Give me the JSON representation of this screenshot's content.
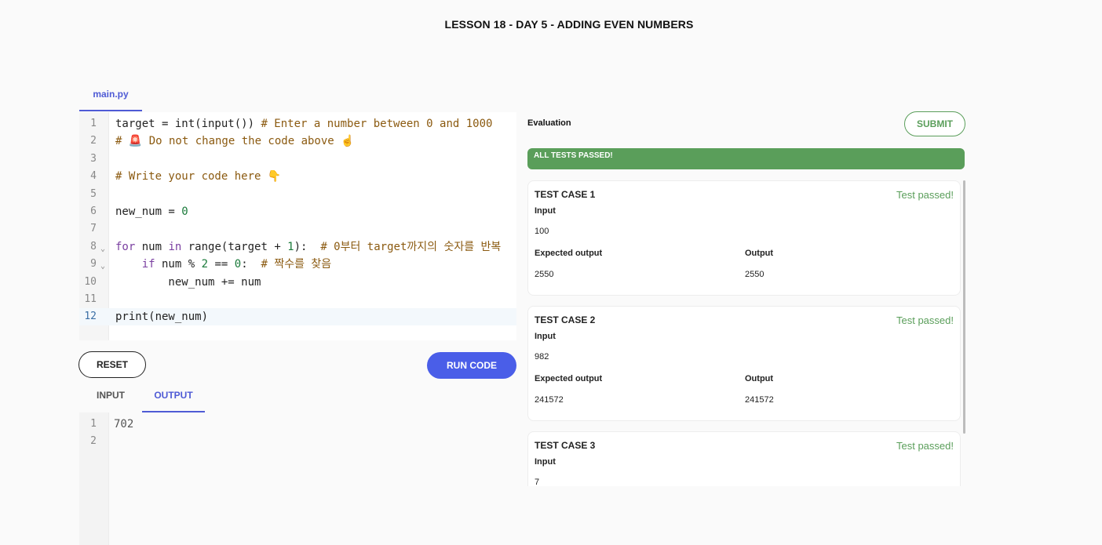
{
  "page_title": "LESSON 18 - DAY 5 - ADDING EVEN NUMBERS",
  "editor": {
    "file_tab": "main.py",
    "lines": [
      {
        "n": "1",
        "html": "target = int(input()) <span class=\"cm\"># Enter a number between 0 and 1000</span>"
      },
      {
        "n": "2",
        "html": "<span class=\"cm\"># 🚨 Do not change the code above ☝️</span>"
      },
      {
        "n": "3",
        "html": ""
      },
      {
        "n": "4",
        "html": "<span class=\"cm\"># Write your code here 👇</span>"
      },
      {
        "n": "5",
        "html": ""
      },
      {
        "n": "6",
        "html": "new_num = <span class=\"num\">0</span>"
      },
      {
        "n": "7",
        "html": ""
      },
      {
        "n": "8",
        "html": "<span class=\"kw\">for</span> num <span class=\"kw\">in</span> range(target + <span class=\"num\">1</span>):  <span class=\"cm\"># 0부터 target까지의 숫자를 반복</span>",
        "fold": true
      },
      {
        "n": "9",
        "html": "    <span class=\"kw\">if</span> num % <span class=\"num\">2</span> == <span class=\"num\">0</span>:  <span class=\"cm\"># 짝수를 찾음</span>",
        "fold": true
      },
      {
        "n": "10",
        "html": "        new_num += num"
      },
      {
        "n": "11",
        "html": ""
      },
      {
        "n": "12",
        "html": "print(new_num)",
        "active": true
      }
    ]
  },
  "buttons": {
    "reset": "RESET",
    "run": "RUN CODE",
    "submit": "SUBMIT"
  },
  "io_tabs": {
    "input": "INPUT",
    "output": "OUTPUT"
  },
  "output": {
    "lines": [
      {
        "n": "1",
        "text": "702"
      },
      {
        "n": "2",
        "text": ""
      }
    ]
  },
  "evaluation": {
    "label": "Evaluation",
    "banner": "ALL TESTS PASSED!",
    "input_label": "Input",
    "expected_label": "Expected output",
    "output_label": "Output",
    "cases": [
      {
        "title": "TEST CASE 1",
        "status": "Test passed!",
        "input": "100",
        "expected": "2550",
        "output": "2550"
      },
      {
        "title": "TEST CASE 2",
        "status": "Test passed!",
        "input": "982",
        "expected": "241572",
        "output": "241572"
      },
      {
        "title": "TEST CASE 3",
        "status": "Test passed!",
        "input": "7",
        "expected": "",
        "output": ""
      }
    ]
  },
  "colors": {
    "accent": "#4a5ee8",
    "success": "#5a9e5a"
  }
}
